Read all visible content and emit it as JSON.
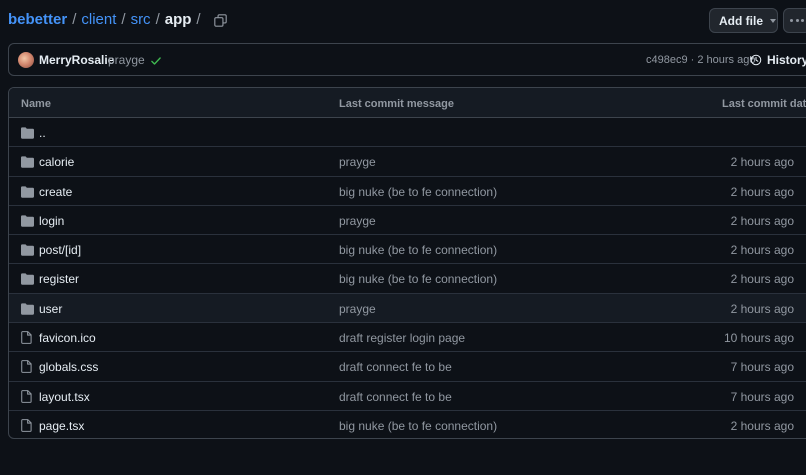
{
  "breadcrumb": {
    "repo": "bebetter",
    "parts": [
      "client",
      "src"
    ],
    "current": "app",
    "separator": "/"
  },
  "toolbar": {
    "add_file_label": "Add file"
  },
  "latest_commit": {
    "author": "MerryRosalie",
    "message": "prayge",
    "meta": "c498ec9 · 2 hours ago",
    "history_label": "History"
  },
  "table": {
    "headers": {
      "name": "Name",
      "message": "Last commit message",
      "date": "Last commit date"
    },
    "parent_row": "..",
    "rows": [
      {
        "type": "folder",
        "name": "calorie",
        "message": "prayge",
        "date": "2 hours ago"
      },
      {
        "type": "folder",
        "name": "create",
        "message": "big nuke (be to fe connection)",
        "date": "2 hours ago"
      },
      {
        "type": "folder",
        "name": "login",
        "message": "prayge",
        "date": "2 hours ago"
      },
      {
        "type": "folder",
        "name": "post/[id]",
        "message": "big nuke (be to fe connection)",
        "date": "2 hours ago"
      },
      {
        "type": "folder",
        "name": "register",
        "message": "big nuke (be to fe connection)",
        "date": "2 hours ago"
      },
      {
        "type": "folder",
        "name": "user",
        "message": "prayge",
        "date": "2 hours ago"
      },
      {
        "type": "file",
        "name": "favicon.ico",
        "message": "draft register login page",
        "date": "10 hours ago"
      },
      {
        "type": "file",
        "name": "globals.css",
        "message": "draft connect fe to be",
        "date": "7 hours ago"
      },
      {
        "type": "file",
        "name": "layout.tsx",
        "message": "draft connect fe to be",
        "date": "7 hours ago"
      },
      {
        "type": "file",
        "name": "page.tsx",
        "message": "big nuke (be to fe connection)",
        "date": "2 hours ago"
      }
    ]
  },
  "colors": {
    "background": "#0d1117",
    "link": "#4493f8",
    "muted": "#9198a1",
    "border": "#3d444d",
    "success": "#3fb950"
  },
  "icons": {
    "copy": "copy-icon",
    "check": "check-icon",
    "history": "history-icon",
    "folder": "folder-icon",
    "file": "file-icon",
    "caret": "triangle-down-icon",
    "more": "kebab-horizontal-icon"
  }
}
